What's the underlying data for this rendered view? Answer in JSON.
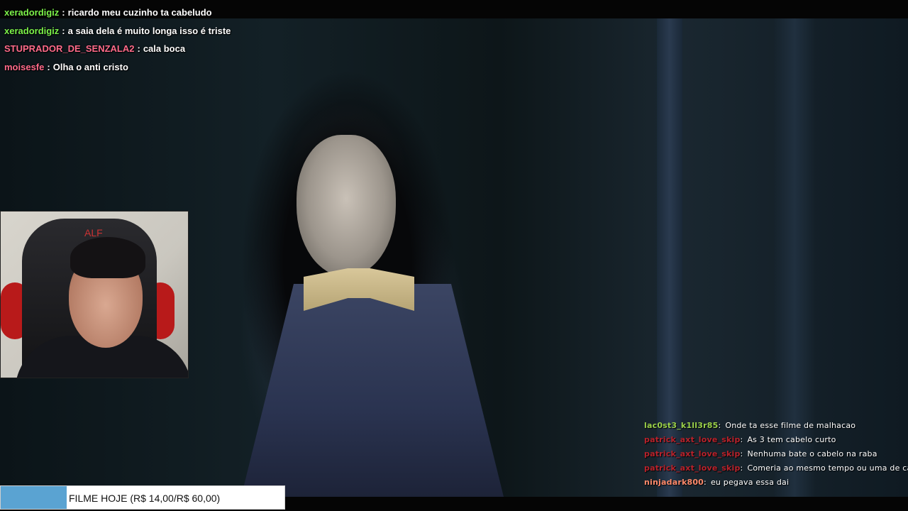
{
  "chat_top": [
    {
      "user": "xeradordigiz",
      "color": "#7cf24a",
      "text": "ricardo meu cuzinho ta cabeludo"
    },
    {
      "user": "xeradordigiz",
      "color": "#7cf24a",
      "text": "a saia dela é muito longa isso é triste"
    },
    {
      "user": "STUPRADOR_DE_SENZALA2",
      "color": "#ff6b8a",
      "text": "cala boca"
    },
    {
      "user": "moisesfe",
      "color": "#ff6b8a",
      "text": "Olha o anti cristo"
    }
  ],
  "chat_bottom": [
    {
      "user": "lac0st3_k1ll3r85",
      "color": "#9bd14a",
      "text": "Onde ta esse filme de malhacao"
    },
    {
      "user": "patrick_axt_love_skip",
      "color": "#b8222b",
      "text": "As 3 tem cabelo curto"
    },
    {
      "user": "patrick_axt_love_skip",
      "color": "#b8222b",
      "text": "Nenhuma bate o cabelo na raba"
    },
    {
      "user": "patrick_axt_love_skip",
      "color": "#b8222b",
      "text": "Comeria ao mesmo tempo ou uma de cada"
    },
    {
      "user": "ninjadark800",
      "color": "#ff8a6b",
      "text": "eu pegava essa dai"
    }
  ],
  "goal": {
    "label": "FILME HOJE (R$ 14,00/R$ 60,00)",
    "current": 14,
    "target": 60,
    "fill_color": "#5aa3d2"
  },
  "webcam": {
    "chair_logo": "ALF"
  }
}
